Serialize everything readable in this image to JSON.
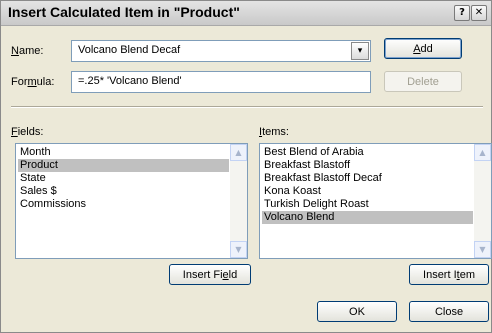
{
  "window": {
    "title": "Insert Calculated Item in \"Product\"",
    "help_glyph": "?",
    "close_glyph": "✕"
  },
  "name": {
    "label_ul": "N",
    "label_rest": "ame:",
    "value": "Volcano Blend Decaf",
    "dropdown_glyph": "▾"
  },
  "formula": {
    "label_pre": "For",
    "label_ul": "m",
    "label_rest": "ula:",
    "value": "=.25* 'Volcano Blend'"
  },
  "buttons": {
    "add_ul": "A",
    "add_rest": "dd",
    "delete": "Delete",
    "insert_field_pre": "Insert Fi",
    "insert_field_ul": "e",
    "insert_field_rest": "ld",
    "insert_item_pre": "Insert I",
    "insert_item_ul": "t",
    "insert_item_rest": "em",
    "ok": "OK",
    "close": "Close"
  },
  "fields": {
    "label_ul": "F",
    "label_rest": "ields:",
    "items": [
      "Month",
      "Product",
      "State",
      "Sales $",
      "Commissions"
    ],
    "selected_index": 1
  },
  "items": {
    "label_ul": "I",
    "label_rest": "tems:",
    "items": [
      "Best Blend of Arabia",
      "Breakfast Blastoff",
      "Breakfast Blastoff Decaf",
      "Kona Koast",
      "Turkish Delight Roast",
      "Volcano Blend"
    ],
    "selected_index": 5
  },
  "scroll": {
    "up_glyph": "▲",
    "down_glyph": "▼"
  }
}
